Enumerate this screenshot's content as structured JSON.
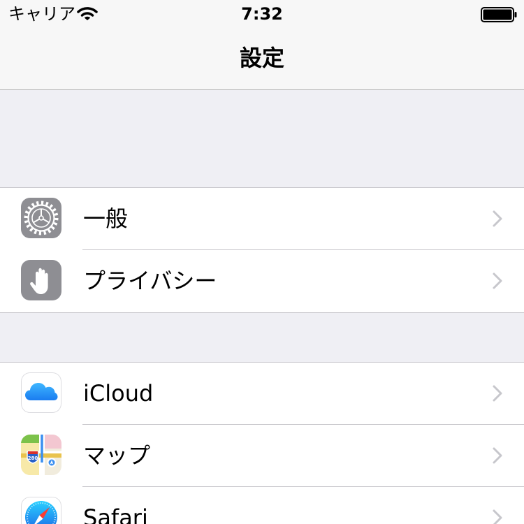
{
  "status_bar": {
    "carrier": "キャリア",
    "time": "7:32",
    "wifi_icon": "wifi-icon",
    "battery_icon": "battery-icon"
  },
  "nav": {
    "title": "設定"
  },
  "groups": [
    {
      "items": [
        {
          "label": "一般",
          "icon": "gear-icon"
        },
        {
          "label": "プライバシー",
          "icon": "hand-icon"
        }
      ]
    },
    {
      "items": [
        {
          "label": "iCloud",
          "icon": "cloud-icon"
        },
        {
          "label": "マップ",
          "icon": "map-icon"
        },
        {
          "label": "Safari",
          "icon": "compass-icon"
        }
      ]
    }
  ],
  "colors": {
    "background": "#efeff4",
    "separator": "#c8c7cc",
    "chevron": "#c7c7cc",
    "settings_icon_gray": "#8e8e93"
  }
}
